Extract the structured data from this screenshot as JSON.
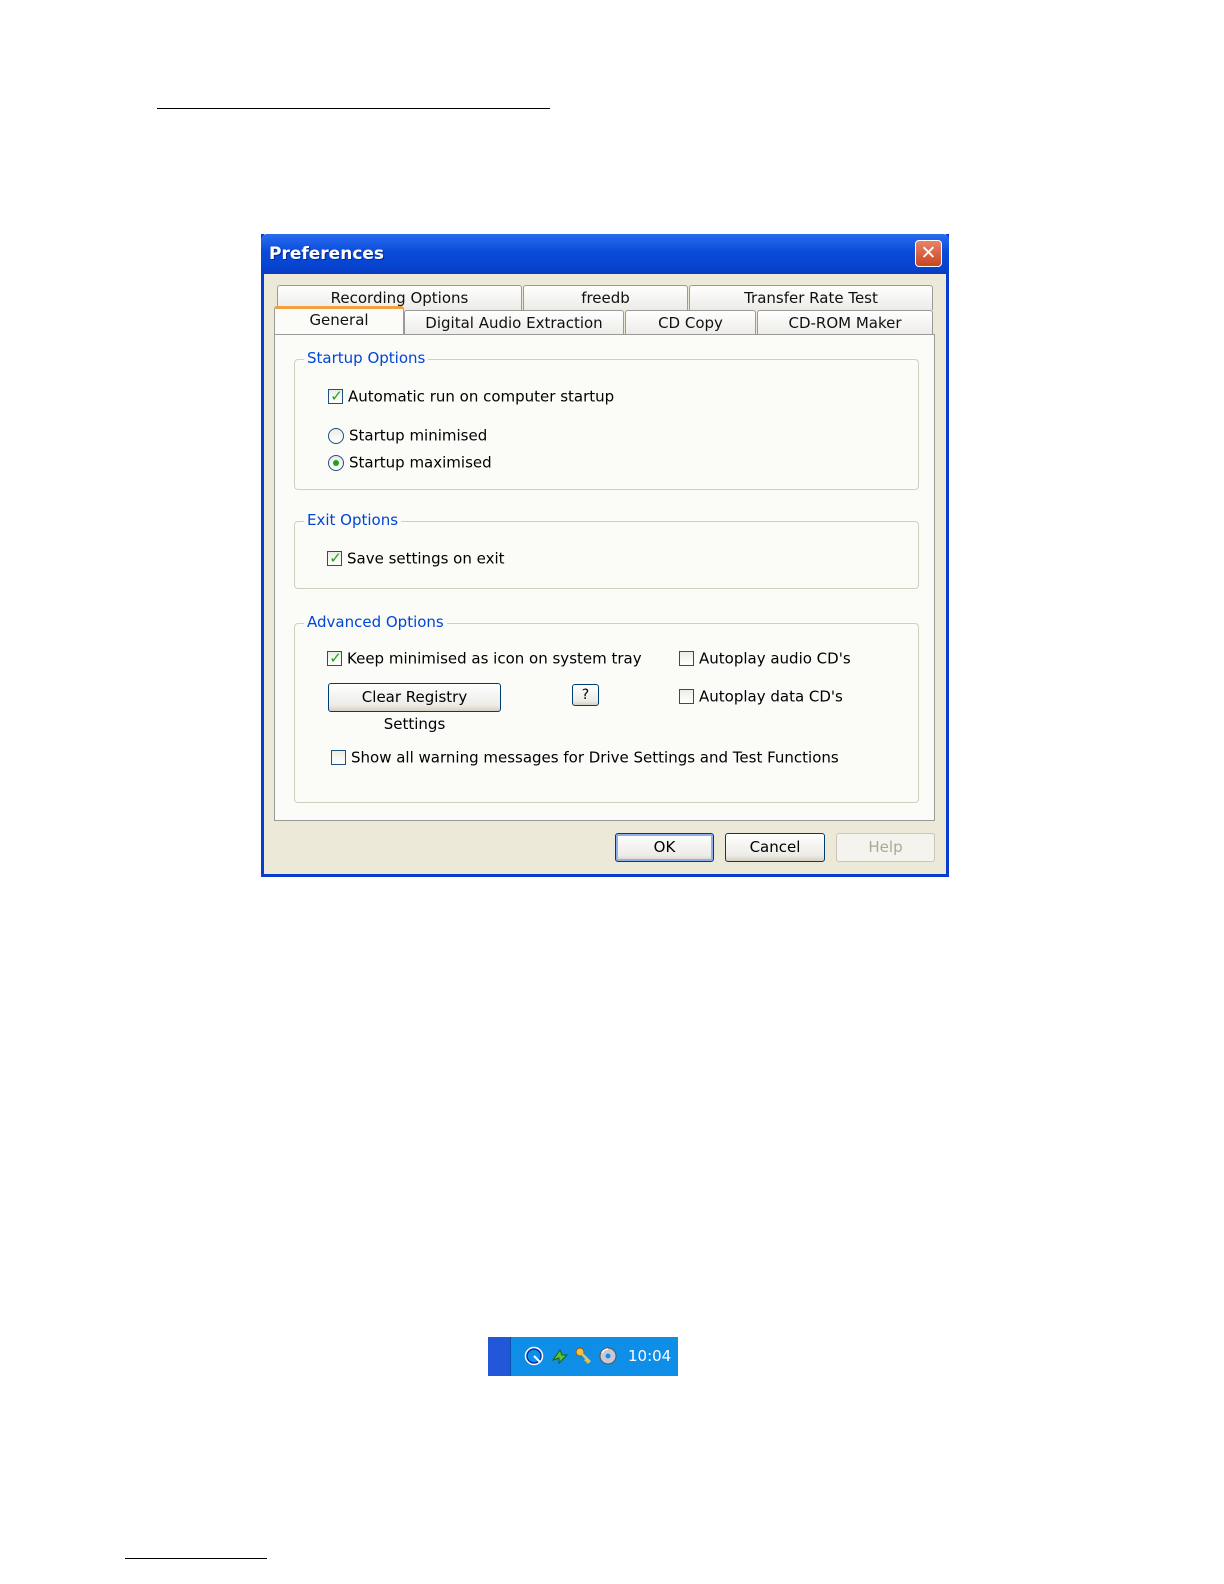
{
  "dialog": {
    "title": "Preferences",
    "close_symbol": "✕",
    "tabs_row1": [
      {
        "label": "Recording Options"
      },
      {
        "label": "freedb"
      },
      {
        "label": "Transfer Rate Test"
      }
    ],
    "tabs_row2": [
      {
        "label": "General",
        "active": true
      },
      {
        "label": "Digital Audio Extraction"
      },
      {
        "label": "CD Copy"
      },
      {
        "label": "CD-ROM Maker"
      }
    ],
    "startup": {
      "title": "Startup Options",
      "auto_run": {
        "label": "Automatic run on computer startup",
        "checked": true
      },
      "minimised": {
        "label": "Startup minimised",
        "selected": false
      },
      "maximised": {
        "label": "Startup maximised",
        "selected": true
      }
    },
    "exit": {
      "title": "Exit Options",
      "save_settings": {
        "label": "Save settings on exit",
        "checked": true
      }
    },
    "advanced": {
      "title": "Advanced Options",
      "keep_minimised": {
        "label": "Keep minimised as icon on system tray",
        "checked": true
      },
      "autoplay_audio": {
        "label": "Autoplay audio CD's",
        "checked": false
      },
      "autoplay_data": {
        "label": "Autoplay data CD's",
        "checked": false
      },
      "clear_registry": "Clear Registry Settings",
      "help_question": "?",
      "show_warnings": {
        "label": "Show all warning messages for Drive Settings and Test Functions",
        "checked": false
      }
    },
    "buttons": {
      "ok": "OK",
      "cancel": "Cancel",
      "help": "Help"
    }
  },
  "tray": {
    "clock": "10:04",
    "icons": [
      "blue-swirl-icon",
      "green-arrow-icon",
      "keys-icon",
      "cd-icon"
    ]
  },
  "colors": {
    "title_blue": "#0a4bd9",
    "group_title": "#0046d5",
    "check_green": "#21a121",
    "tray_blue": "#0f8ee8"
  }
}
